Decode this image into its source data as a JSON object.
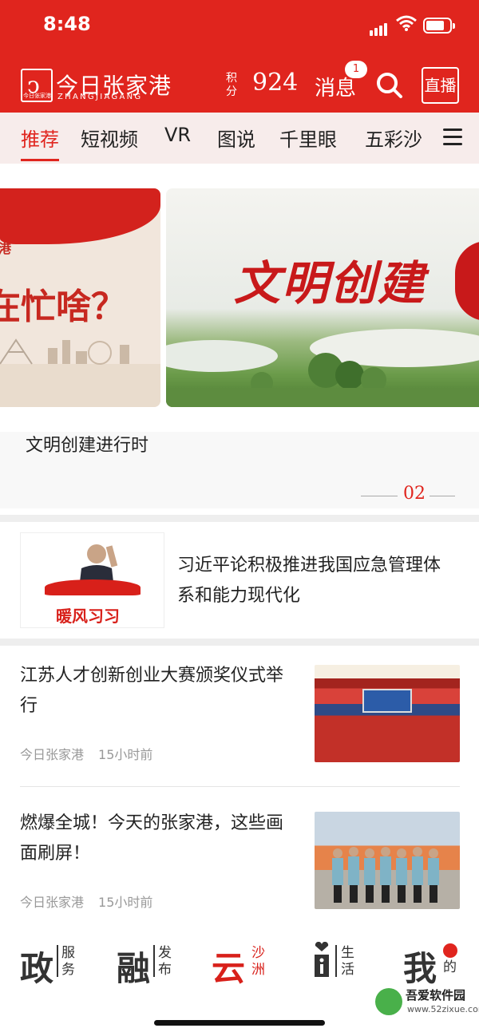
{
  "status_bar": {
    "time": "8:48"
  },
  "header": {
    "brand_cn": "今日张家港",
    "brand_en": "ZHANGJIAGANG",
    "logo_small_text": "今日张家港",
    "points_label": "积分",
    "points_value": "924",
    "messages_label": "消息",
    "messages_badge": "1",
    "live_label": "直播",
    "accent_color": "#e0251e"
  },
  "tabs": [
    {
      "label": "推荐",
      "active": true
    },
    {
      "label": "短视频"
    },
    {
      "label": "VR"
    },
    {
      "label": "图说"
    },
    {
      "label": "千里眼"
    },
    {
      "label": "五彩沙"
    }
  ],
  "carousel": {
    "left_banner_text": "在忙啥？",
    "left_banner_small": "港",
    "right_banner_text": "文明创建",
    "caption": "文明创建进行时",
    "page_number": "02"
  },
  "feature": {
    "card_label": "暖风习习",
    "title": "习近平论积极推进我国应急管理体系和能力现代化"
  },
  "news": [
    {
      "title": "江苏人才创新创业大赛颁奖仪式举行",
      "source": "今日张家港",
      "time": "15小时前"
    },
    {
      "title": "燃爆全城！今天的张家港，这些画面刷屏！",
      "source": "今日张家港",
      "time": "15小时前"
    }
  ],
  "bottom_nav": [
    {
      "big": "政",
      "small": "服务"
    },
    {
      "big": "融",
      "small": "发布"
    },
    {
      "big": "云",
      "small": "沙洲",
      "active": true
    },
    {
      "big": "i",
      "small": "生活"
    },
    {
      "big": "我",
      "small": "的"
    }
  ],
  "watermark": {
    "name": "吾爱软件园",
    "url": "www.52zixue.com"
  }
}
